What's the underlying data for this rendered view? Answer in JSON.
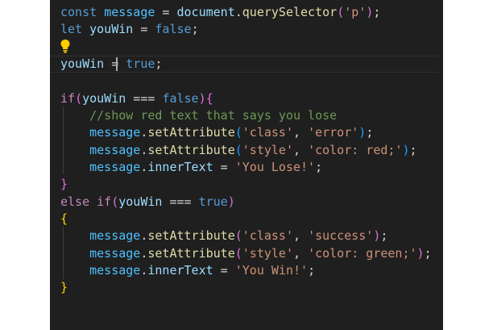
{
  "editor": {
    "language": "javascript",
    "theme_background": "#1f1f1f",
    "lines": [
      {
        "id": "line-1",
        "tokens": [
          {
            "t": "const",
            "c": "kw-decl"
          },
          {
            "t": " ",
            "c": "plain"
          },
          {
            "t": "message",
            "c": "const-var"
          },
          {
            "t": " = ",
            "c": "op"
          },
          {
            "t": "document",
            "c": "var"
          },
          {
            "t": ".",
            "c": "plain"
          },
          {
            "t": "querySelector",
            "c": "fn"
          },
          {
            "t": "(",
            "c": "paren"
          },
          {
            "t": "'p'",
            "c": "str"
          },
          {
            "t": ")",
            "c": "paren"
          },
          {
            "t": ";",
            "c": "plain"
          }
        ]
      },
      {
        "id": "line-2",
        "tokens": [
          {
            "t": "let",
            "c": "kw-decl"
          },
          {
            "t": " ",
            "c": "plain"
          },
          {
            "t": "youWin",
            "c": "var"
          },
          {
            "t": " = ",
            "c": "op"
          },
          {
            "t": "false",
            "c": "bool"
          },
          {
            "t": ";",
            "c": "plain"
          }
        ]
      },
      {
        "id": "line-3",
        "tokens": []
      },
      {
        "id": "line-4",
        "tokens": [
          {
            "t": "youWin",
            "c": "var"
          },
          {
            "t": " = ",
            "c": "op"
          },
          {
            "t": "true",
            "c": "bool"
          },
          {
            "t": ";",
            "c": "plain"
          }
        ]
      },
      {
        "id": "line-5",
        "tokens": []
      },
      {
        "id": "line-6",
        "tokens": [
          {
            "t": "if",
            "c": "kw-ctrl"
          },
          {
            "t": "(",
            "c": "paren"
          },
          {
            "t": "youWin",
            "c": "var"
          },
          {
            "t": " === ",
            "c": "op"
          },
          {
            "t": "false",
            "c": "bool"
          },
          {
            "t": ")",
            "c": "paren"
          },
          {
            "t": "{",
            "c": "paren"
          }
        ]
      },
      {
        "id": "line-7",
        "tokens": [
          {
            "t": "    //show red text that says you lose",
            "c": "comment"
          }
        ]
      },
      {
        "id": "line-8",
        "tokens": [
          {
            "t": "    ",
            "c": "plain"
          },
          {
            "t": "message",
            "c": "const-var"
          },
          {
            "t": ".",
            "c": "plain"
          },
          {
            "t": "setAttribute",
            "c": "fn"
          },
          {
            "t": "(",
            "c": "paren2"
          },
          {
            "t": "'class'",
            "c": "str"
          },
          {
            "t": ", ",
            "c": "plain"
          },
          {
            "t": "'error'",
            "c": "str"
          },
          {
            "t": ")",
            "c": "paren2"
          },
          {
            "t": ";",
            "c": "plain"
          }
        ]
      },
      {
        "id": "line-9",
        "tokens": [
          {
            "t": "    ",
            "c": "plain"
          },
          {
            "t": "message",
            "c": "const-var"
          },
          {
            "t": ".",
            "c": "plain"
          },
          {
            "t": "setAttribute",
            "c": "fn"
          },
          {
            "t": "(",
            "c": "paren2"
          },
          {
            "t": "'style'",
            "c": "str"
          },
          {
            "t": ", ",
            "c": "plain"
          },
          {
            "t": "'color: red;'",
            "c": "str"
          },
          {
            "t": ")",
            "c": "paren2"
          },
          {
            "t": ";",
            "c": "plain"
          }
        ]
      },
      {
        "id": "line-10",
        "tokens": [
          {
            "t": "    ",
            "c": "plain"
          },
          {
            "t": "message",
            "c": "const-var"
          },
          {
            "t": ".",
            "c": "plain"
          },
          {
            "t": "innerText",
            "c": "var"
          },
          {
            "t": " = ",
            "c": "op"
          },
          {
            "t": "'You Lose!'",
            "c": "str"
          },
          {
            "t": ";",
            "c": "plain"
          }
        ]
      },
      {
        "id": "line-11",
        "tokens": [
          {
            "t": "}",
            "c": "paren"
          }
        ]
      },
      {
        "id": "line-12",
        "tokens": [
          {
            "t": "else",
            "c": "kw-ctrl"
          },
          {
            "t": " ",
            "c": "plain"
          },
          {
            "t": "if",
            "c": "kw-ctrl"
          },
          {
            "t": "(",
            "c": "paren"
          },
          {
            "t": "youWin",
            "c": "var"
          },
          {
            "t": " === ",
            "c": "op"
          },
          {
            "t": "true",
            "c": "bool"
          },
          {
            "t": ")",
            "c": "paren"
          }
        ]
      },
      {
        "id": "line-13",
        "tokens": [
          {
            "t": "{",
            "c": "brace"
          }
        ]
      },
      {
        "id": "line-14",
        "tokens": [
          {
            "t": "    ",
            "c": "plain"
          },
          {
            "t": "message",
            "c": "const-var"
          },
          {
            "t": ".",
            "c": "plain"
          },
          {
            "t": "setAttribute",
            "c": "fn"
          },
          {
            "t": "(",
            "c": "paren"
          },
          {
            "t": "'class'",
            "c": "str"
          },
          {
            "t": ", ",
            "c": "plain"
          },
          {
            "t": "'success'",
            "c": "str"
          },
          {
            "t": ")",
            "c": "paren"
          },
          {
            "t": ";",
            "c": "plain"
          }
        ]
      },
      {
        "id": "line-15",
        "tokens": [
          {
            "t": "    ",
            "c": "plain"
          },
          {
            "t": "message",
            "c": "const-var"
          },
          {
            "t": ".",
            "c": "plain"
          },
          {
            "t": "setAttribute",
            "c": "fn"
          },
          {
            "t": "(",
            "c": "paren"
          },
          {
            "t": "'style'",
            "c": "str"
          },
          {
            "t": ", ",
            "c": "plain"
          },
          {
            "t": "'color: green;'",
            "c": "str"
          },
          {
            "t": ")",
            "c": "paren"
          },
          {
            "t": ";",
            "c": "plain"
          }
        ]
      },
      {
        "id": "line-16",
        "tokens": [
          {
            "t": "    ",
            "c": "plain"
          },
          {
            "t": "message",
            "c": "const-var"
          },
          {
            "t": ".",
            "c": "plain"
          },
          {
            "t": "innerText",
            "c": "var"
          },
          {
            "t": " = ",
            "c": "op"
          },
          {
            "t": "'You Win!'",
            "c": "str"
          },
          {
            "t": ";",
            "c": "plain"
          }
        ]
      },
      {
        "id": "line-17",
        "tokens": [
          {
            "t": "}",
            "c": "brace"
          }
        ]
      }
    ],
    "lightbulb_icon": "lightbulb-icon",
    "colors": {
      "keyword_declaration": "#569cd6",
      "keyword_control": "#c586c0",
      "function": "#dcdcaa",
      "string": "#ce9178",
      "comment": "#6a9955",
      "variable": "#9cdcfe"
    }
  }
}
